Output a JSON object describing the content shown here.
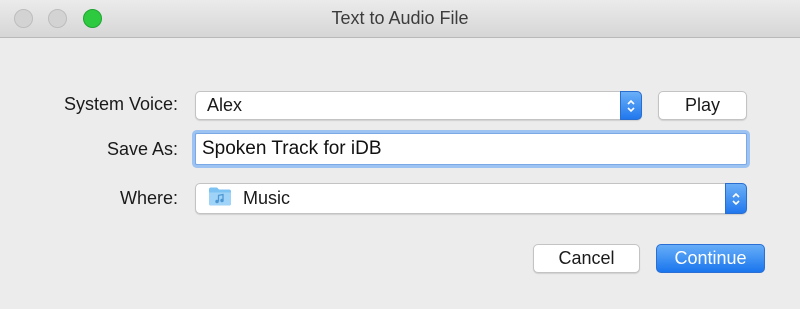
{
  "window": {
    "title": "Text to Audio File"
  },
  "form": {
    "voice_label": "System Voice:",
    "voice_value": "Alex",
    "play_label": "Play",
    "save_as_label": "Save As:",
    "save_as_value": "Spoken Track for iDB",
    "where_label": "Where:",
    "where_value": "Music",
    "where_icon": "music-folder-icon"
  },
  "buttons": {
    "cancel_label": "Cancel",
    "continue_label": "Continue"
  },
  "colors": {
    "accent": "#1a76ee",
    "zoom_light": "#2dc93f",
    "window_bg": "#ececec"
  }
}
